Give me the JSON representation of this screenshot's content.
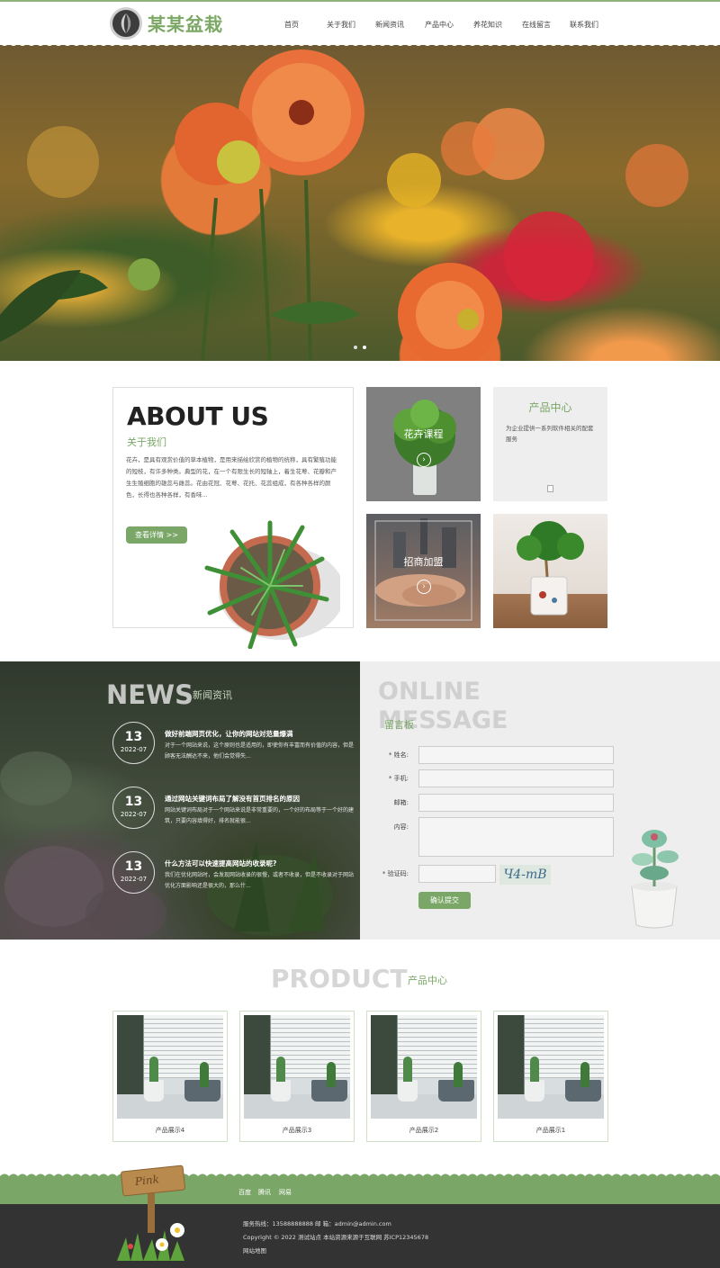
{
  "site": {
    "logo_text": "某某盆栽"
  },
  "nav": [
    {
      "label": "首页"
    },
    {
      "label": "关于我们"
    },
    {
      "label": "新闻资讯"
    },
    {
      "label": "产品中心"
    },
    {
      "label": "养花知识"
    },
    {
      "label": "在线留言"
    },
    {
      "label": "联系我们"
    }
  ],
  "hero": {
    "slides": 2,
    "active_slide": 1
  },
  "about": {
    "title": "ABOUT US",
    "subtitle": "关于我们",
    "body": "花卉，是具有观赏价值的草本植物，是用来描绘欣赏的植物的统称，具有繁殖功能的短枝，有许多种类。典型的花，在一个有限生长的短轴上，着生花萼、花瓣和产生生殖细胞的雄蕊与雌蕊。花由花冠、花萼、花托、花蕊组成，有各种各样的颜色，长得也各种各样，有香味...",
    "button": "查看详情 >>"
  },
  "tiles": {
    "tile1_label": "花卉课程",
    "tile2_label": "招商加盟",
    "product_title": "产品中心",
    "product_desc": "为企业提供一系列软件相关的配套服务"
  },
  "news": {
    "title": "NEWS",
    "subtitle": "新闻资讯",
    "items": [
      {
        "day": "13",
        "ym": "2022-07",
        "title": "做好前端网页优化，让你的网站対范量爆满",
        "desc": "对于一个网站来说，这个原则也是适用的，即使你有丰富而有价值的内容，但是顾客无法酬达不来，他们会觉得失..."
      },
      {
        "day": "13",
        "ym": "2022-07",
        "title": "通过网站关键词布局了解没有首页排名的原因",
        "desc": "网站关键词布局对于一个网站来说是非常重要的，一个好的布局等于一个好的建筑，只要内容填得好，排名就能很..."
      },
      {
        "day": "13",
        "ym": "2022-07",
        "title": "什么方法可以快速提高网站的收录呢?",
        "desc": "我们在优化网站时，会发现网站收录的很慢，或者不收录，但是不收录对于网站优化方面影响还是很大的，那么什..."
      }
    ]
  },
  "message": {
    "title_line1": "ONLINE",
    "title_line2": "MESSAGE",
    "subtitle": "留言板",
    "fields": [
      {
        "label": "* 姓名:"
      },
      {
        "label": "* 手机:"
      },
      {
        "label": "邮箱:"
      },
      {
        "label": "内容:"
      },
      {
        "label": "* 验证码:"
      }
    ],
    "captcha": "Ч4-mB",
    "submit": "确认提交"
  },
  "products": {
    "title": "PRODUCT",
    "subtitle": "产品中心",
    "items": [
      {
        "label": "产品展示4"
      },
      {
        "label": "产品展示3"
      },
      {
        "label": "产品展示2"
      },
      {
        "label": "产品展示1"
      }
    ]
  },
  "footer": {
    "links": [
      "百度",
      "腾讯",
      "网易"
    ],
    "hotline": "服务热线：13588888888   邮 箱：admin@admin.com",
    "copyright": "Copyright © 2022 测试站点 本站资源来源于互联网   苏ICP12345678",
    "sitemap": "网站地图",
    "sign_text": "Pink"
  },
  "colors": {
    "accent": "#7aa767",
    "dark_footer": "#333333",
    "message_bg": "#eeeeee"
  }
}
